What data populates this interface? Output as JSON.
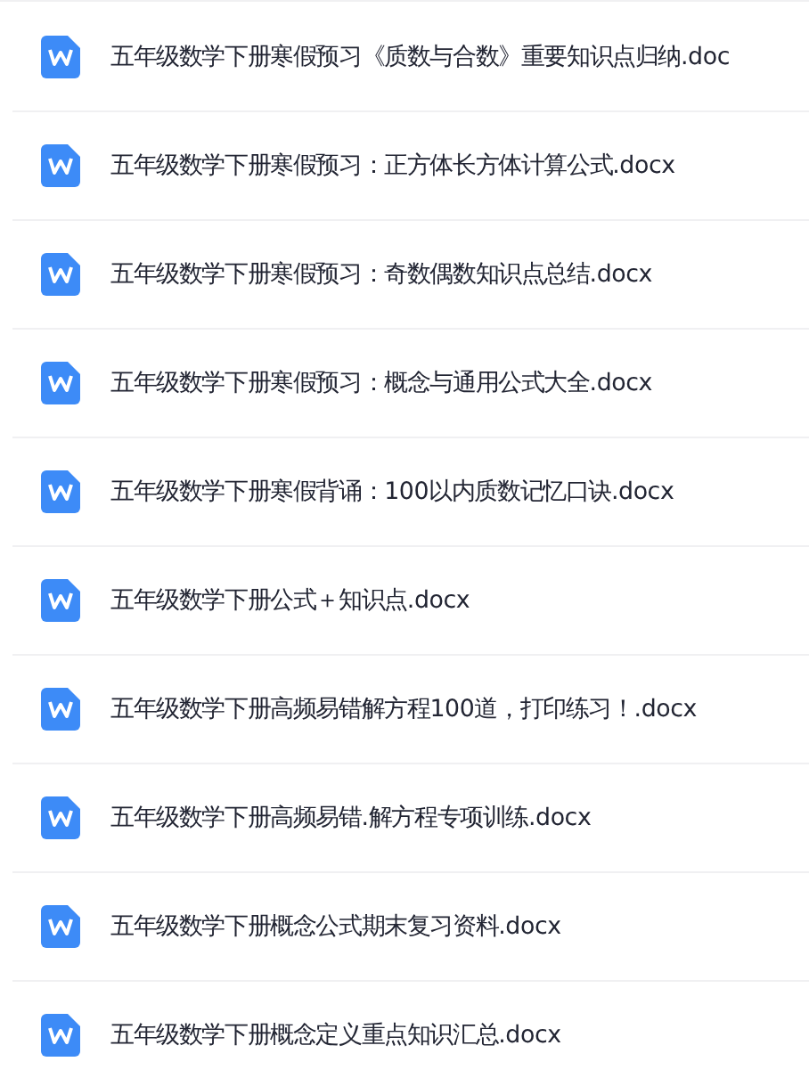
{
  "files": [
    {
      "name": "五年级数学下册寒假预习《质数与合数》重要知识点归纳.doc"
    },
    {
      "name": "五年级数学下册寒假预习：正方体长方体计算公式.docx"
    },
    {
      "name": "五年级数学下册寒假预习：奇数偶数知识点总结.docx"
    },
    {
      "name": "五年级数学下册寒假预习：概念与通用公式大全.docx"
    },
    {
      "name": "五年级数学下册寒假背诵：100以内质数记忆口诀.docx"
    },
    {
      "name": "五年级数学下册公式＋知识点.docx"
    },
    {
      "name": "五年级数学下册高频易错解方程100道，打印练习！.docx"
    },
    {
      "name": "五年级数学下册高频易错.解方程专项训练.docx"
    },
    {
      "name": "五年级数学下册概念公式期末复习资料.docx"
    },
    {
      "name": "五年级数学下册概念定义重点知识汇总.docx"
    }
  ]
}
